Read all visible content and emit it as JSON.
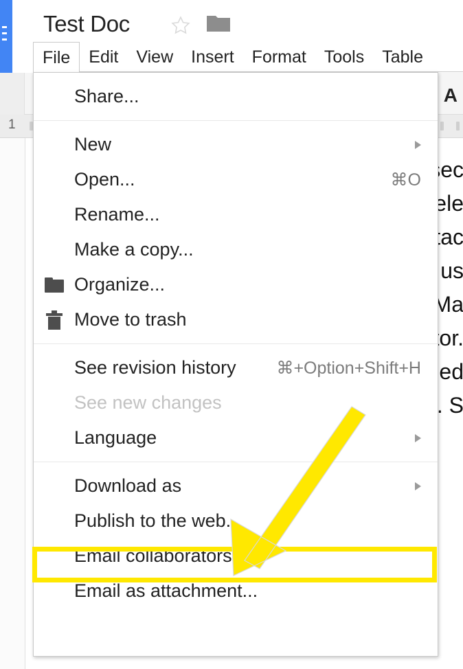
{
  "app": {
    "logo_icon": "google-docs-logo",
    "doc_title": "Test Doc",
    "star_icon": "star-outline-icon",
    "folder_icon": "folder-icon"
  },
  "menubar": {
    "items": [
      {
        "label": "File",
        "active": true
      },
      {
        "label": "Edit",
        "active": false
      },
      {
        "label": "View",
        "active": false
      },
      {
        "label": "Insert",
        "active": false
      },
      {
        "label": "Format",
        "active": false
      },
      {
        "label": "Tools",
        "active": false
      },
      {
        "label": "Table",
        "active": false
      }
    ]
  },
  "toolbar": {
    "text_color_label": "A"
  },
  "ruler": {
    "tick_label": "1"
  },
  "document": {
    "lines": [
      "sec",
      "ele",
      "tac",
      "us",
      "Ma",
      "tor.",
      "ned",
      ". S"
    ]
  },
  "file_menu": {
    "groups": [
      {
        "items": [
          {
            "label": "Share...",
            "icon": null,
            "accel": null,
            "submenu": false,
            "disabled": false,
            "highlighted": false
          }
        ]
      },
      {
        "items": [
          {
            "label": "New",
            "icon": null,
            "accel": null,
            "submenu": true,
            "disabled": false,
            "highlighted": false
          },
          {
            "label": "Open...",
            "icon": null,
            "accel": "⌘O",
            "submenu": false,
            "disabled": false,
            "highlighted": false
          },
          {
            "label": "Rename...",
            "icon": null,
            "accel": null,
            "submenu": false,
            "disabled": false,
            "highlighted": false
          },
          {
            "label": "Make a copy...",
            "icon": null,
            "accel": null,
            "submenu": false,
            "disabled": false,
            "highlighted": false
          },
          {
            "label": "Organize...",
            "icon": "folder-icon",
            "accel": null,
            "submenu": false,
            "disabled": false,
            "highlighted": false
          },
          {
            "label": "Move to trash",
            "icon": "trash-icon",
            "accel": null,
            "submenu": false,
            "disabled": false,
            "highlighted": false
          }
        ]
      },
      {
        "items": [
          {
            "label": "See revision history",
            "icon": null,
            "accel": "⌘+Option+Shift+H",
            "submenu": false,
            "disabled": false,
            "highlighted": false
          },
          {
            "label": "See new changes",
            "icon": null,
            "accel": null,
            "submenu": false,
            "disabled": true,
            "highlighted": false
          },
          {
            "label": "Language",
            "icon": null,
            "accel": null,
            "submenu": true,
            "disabled": false,
            "highlighted": false
          }
        ]
      },
      {
        "items": [
          {
            "label": "Download as",
            "icon": null,
            "accel": null,
            "submenu": true,
            "disabled": false,
            "highlighted": false
          },
          {
            "label": "Publish to the web...",
            "icon": null,
            "accel": null,
            "submenu": false,
            "disabled": false,
            "highlighted": true
          },
          {
            "label": "Email collaborators...",
            "icon": null,
            "accel": null,
            "submenu": false,
            "disabled": false,
            "highlighted": false
          },
          {
            "label": "Email as attachment...",
            "icon": null,
            "accel": null,
            "submenu": false,
            "disabled": false,
            "highlighted": false
          }
        ]
      }
    ]
  },
  "annotation": {
    "highlight_color": "#ffe800",
    "target_label": "Publish to the web...",
    "arrow_icon": "arrow-pointing-down-left"
  }
}
